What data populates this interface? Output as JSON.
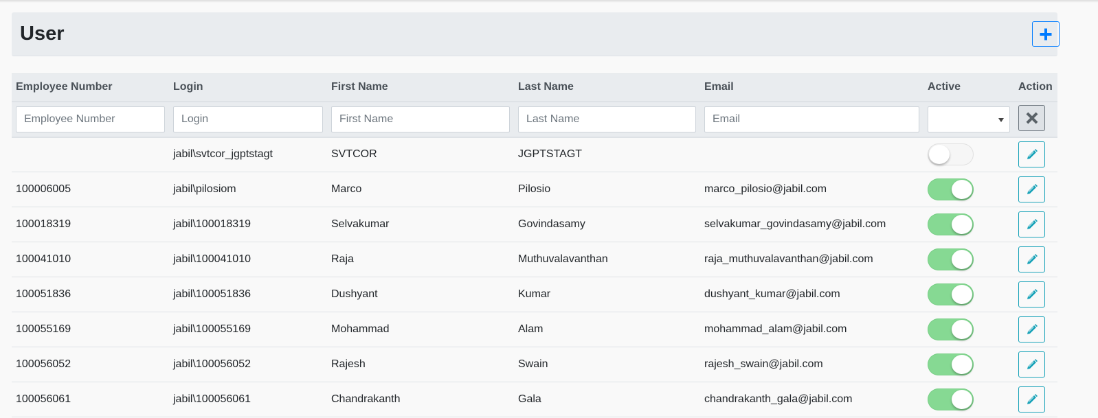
{
  "header": {
    "title": "User",
    "add_icon": "plus-icon"
  },
  "columns": [
    "Employee Number",
    "Login",
    "First Name",
    "Last Name",
    "Email",
    "Active",
    "Action"
  ],
  "filters": {
    "employee_number": "Employee Number",
    "login": "Login",
    "first_name": "First Name",
    "last_name": "Last Name",
    "email": "Email",
    "active": "",
    "clear_icon": "times-icon"
  },
  "rows": [
    {
      "emp": "",
      "login": "jabil\\svtcor_jgptstagt",
      "first": "SVTCOR",
      "last": "JGPTSTAGT",
      "email": "",
      "active": false
    },
    {
      "emp": "100006005",
      "login": "jabil\\pilosiom",
      "first": "Marco",
      "last": "Pilosio",
      "email": "marco_pilosio@jabil.com",
      "active": true
    },
    {
      "emp": "100018319",
      "login": "jabil\\100018319",
      "first": "Selvakumar",
      "last": "Govindasamy",
      "email": "selvakumar_govindasamy@jabil.com",
      "active": true
    },
    {
      "emp": "100041010",
      "login": "jabil\\100041010",
      "first": "Raja",
      "last": "Muthuvalavanthan",
      "email": "raja_muthuvalavanthan@jabil.com",
      "active": true
    },
    {
      "emp": "100051836",
      "login": "jabil\\100051836",
      "first": "Dushyant",
      "last": "Kumar",
      "email": "dushyant_kumar@jabil.com",
      "active": true
    },
    {
      "emp": "100055169",
      "login": "jabil\\100055169",
      "first": "Mohammad",
      "last": "Alam",
      "email": "mohammad_alam@jabil.com",
      "active": true
    },
    {
      "emp": "100056052",
      "login": "jabil\\100056052",
      "first": "Rajesh",
      "last": "Swain",
      "email": "rajesh_swain@jabil.com",
      "active": true
    },
    {
      "emp": "100056061",
      "login": "jabil\\100056061",
      "first": "Chandrakanth",
      "last": "Gala",
      "email": "chandrakanth_gala@jabil.com",
      "active": true
    }
  ],
  "colors": {
    "accent": "#007bff",
    "edit": "#17a2b8",
    "toggle_on": "#86d993"
  }
}
